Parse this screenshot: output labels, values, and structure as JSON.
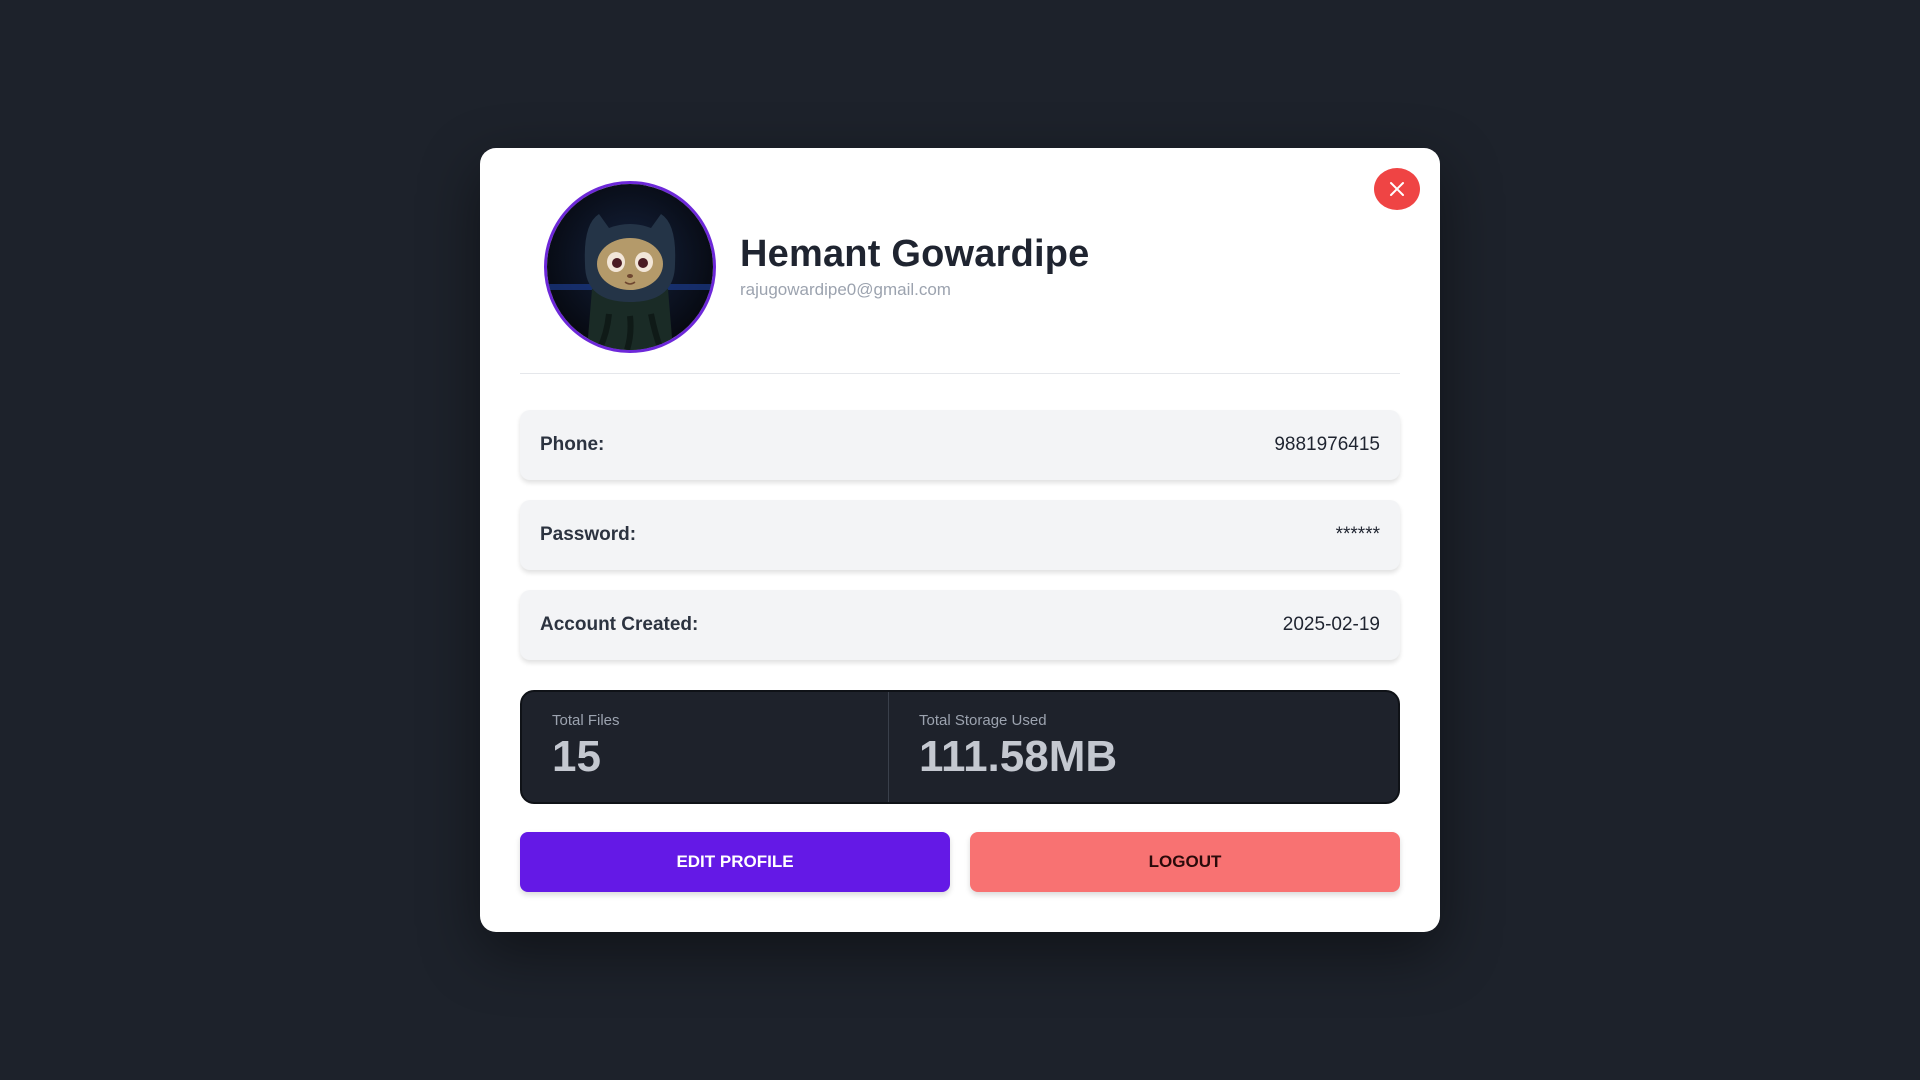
{
  "profile": {
    "name": "Hemant Gowardipe",
    "email": "rajugowardipe0@gmail.com"
  },
  "info": {
    "phone_label": "Phone:",
    "phone_value": "9881976415",
    "password_label": "Password:",
    "password_value": "******",
    "created_label": "Account Created:",
    "created_value": "2025-02-19"
  },
  "stats": {
    "files_label": "Total Files",
    "files_value": "15",
    "storage_label": "Total Storage Used",
    "storage_value": "111.58MB"
  },
  "actions": {
    "edit_label": "EDIT PROFILE",
    "logout_label": "LOGOUT"
  },
  "colors": {
    "background": "#1d222b",
    "accent": "#6419e6",
    "danger": "#ef4444",
    "logout": "#f87272"
  },
  "icons": {
    "close": "close-icon",
    "avatar": "octocat-avatar"
  }
}
